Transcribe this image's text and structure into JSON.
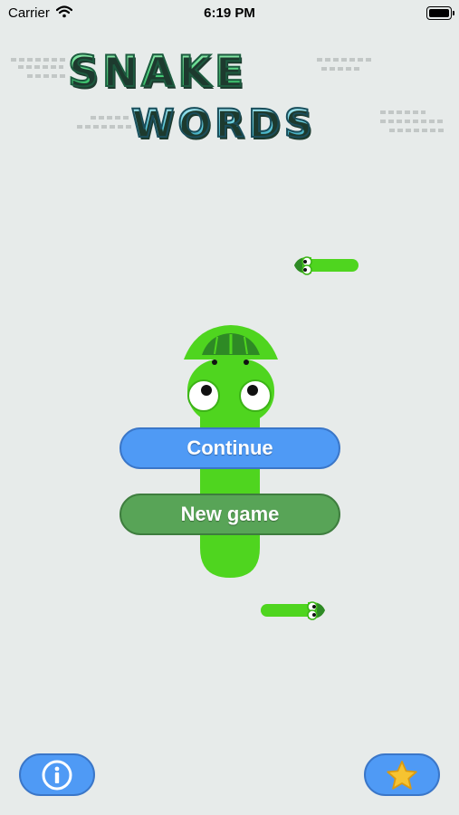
{
  "status_bar": {
    "carrier": "Carrier",
    "time": "6:19 PM"
  },
  "title": {
    "line1": "SNAKE",
    "line2": "WORDS"
  },
  "menu": {
    "continue_label": "Continue",
    "new_game_label": "New game"
  },
  "bottom": {
    "info_icon": "info-icon",
    "star_icon": "star-icon"
  },
  "colors": {
    "background": "#e7ebea",
    "snake_green": "#4fd51f",
    "continue_blue": "#4f9af5",
    "new_game_green": "#58a457",
    "star_yellow": "#f6c331"
  }
}
